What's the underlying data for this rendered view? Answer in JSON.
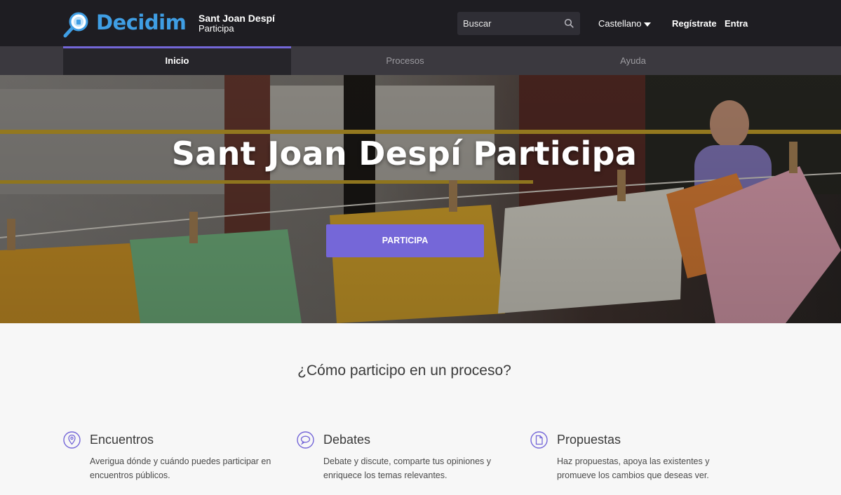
{
  "header": {
    "logo_text": "Decidim",
    "org_name": "Sant Joan Despí",
    "org_subtitle": "Participa",
    "search": {
      "placeholder": "Buscar",
      "icon": "search-icon"
    },
    "language": "Castellano",
    "register_label": "Regístrate",
    "login_label": "Entra"
  },
  "nav": {
    "tabs": [
      {
        "label": "Inicio",
        "active": true
      },
      {
        "label": "Procesos",
        "active": false
      },
      {
        "label": "Ayuda",
        "active": false
      }
    ]
  },
  "hero": {
    "title": "Sant Joan Despí Participa",
    "cta_label": "PARTICIPA"
  },
  "how": {
    "title": "¿Cómo participo en un proceso?",
    "features": [
      {
        "icon": "location-pin-icon",
        "title": "Encuentros",
        "description": "Averigua dónde y cuándo puedes participar en encuentros públicos."
      },
      {
        "icon": "speech-bubble-icon",
        "title": "Debates",
        "description": "Debate y discute, comparte tus opiniones y enriquece los temas relevantes."
      },
      {
        "icon": "document-icon",
        "title": "Propuestas",
        "description": "Haz propuestas, apoya las existentes y promueve los cambios que deseas ver."
      }
    ]
  },
  "colors": {
    "topbar": "#1e1d22",
    "navbar": "#3b393f",
    "accent": "#7567d8",
    "logo_blue": "#3f9ee4"
  }
}
